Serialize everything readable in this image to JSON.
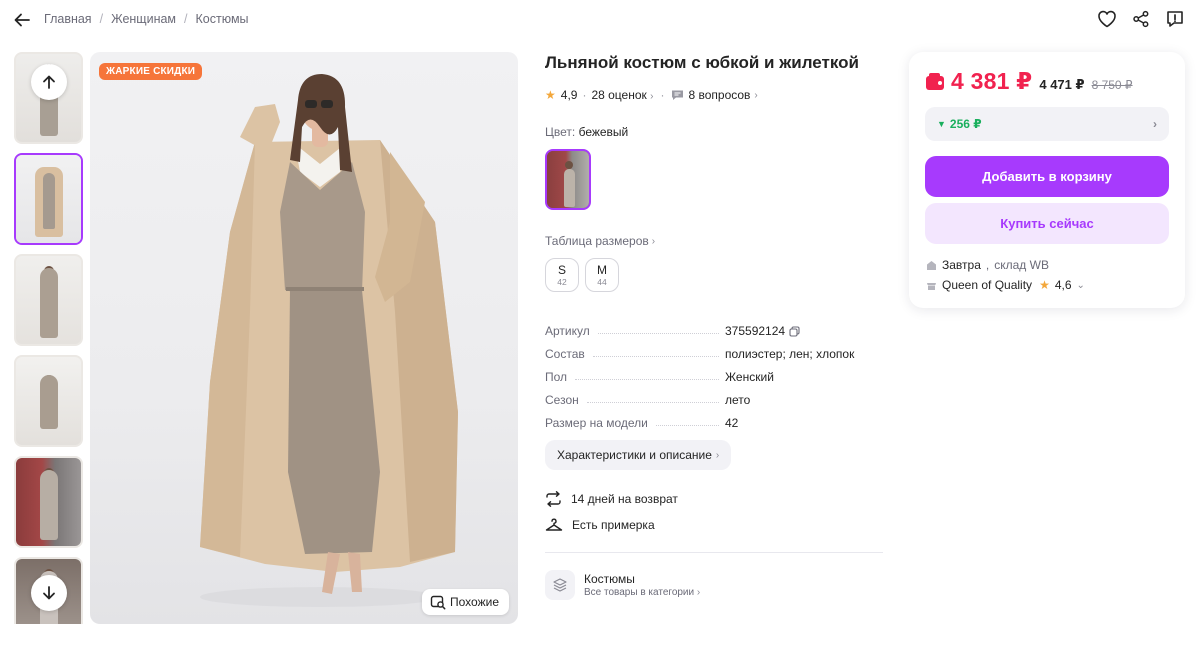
{
  "breadcrumbs": [
    "Главная",
    "Женщинам",
    "Костюмы"
  ],
  "badge": "ЖАРКИЕ СКИДКИ",
  "similar_label": "Похожие",
  "title": "Льняной костюм с юбкой и жилеткой",
  "rating": {
    "value": "4,9",
    "reviews": "28 оценок",
    "questions": "8 вопросов"
  },
  "color": {
    "label": "Цвет:",
    "value": "бежевый"
  },
  "size_table_label": "Таблица размеров",
  "sizes": [
    {
      "label": "S",
      "number": "42"
    },
    {
      "label": "M",
      "number": "44"
    }
  ],
  "specs": [
    {
      "key": "Артикул",
      "value": "375592124"
    },
    {
      "key": "Состав",
      "value": "полиэстер; лен; хлопок"
    },
    {
      "key": "Пол",
      "value": "Женский"
    },
    {
      "key": "Сезон",
      "value": "лето"
    },
    {
      "key": "Размер на модели",
      "value": "42"
    }
  ],
  "characteristics_label": "Характеристики и описание",
  "perks": {
    "return": "14 дней на возврат",
    "fitting": "Есть примерка"
  },
  "category": {
    "title": "Костюмы",
    "subtitle": "Все товары в категории"
  },
  "price": {
    "current": "4 381 ₽",
    "alt": "4 471 ₽",
    "old": "8 750 ₽"
  },
  "discount": "256 ₽",
  "add_to_cart": "Добавить в корзину",
  "buy_now": "Купить сейчас",
  "delivery": {
    "day": "Завтра",
    "warehouse": "склад WB"
  },
  "seller": {
    "name": "Queen of Quality",
    "rating": "4,6"
  },
  "colors": {
    "accent": "#a73afd",
    "price": "#f1224f",
    "discount": "#1aaf5d",
    "badge": "#f6753a"
  }
}
